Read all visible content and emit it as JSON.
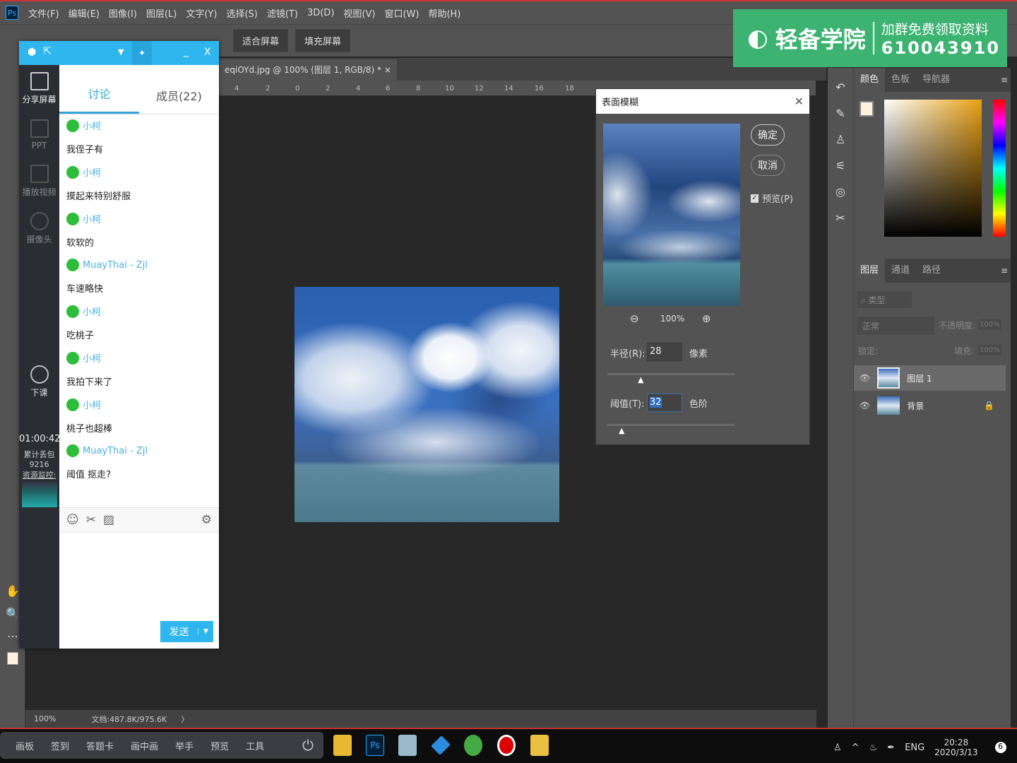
{
  "menu": {
    "items": [
      "文件(F)",
      "编辑(E)",
      "图像(I)",
      "图层(L)",
      "文字(Y)",
      "选择(S)",
      "滤镜(T)",
      "3D(D)",
      "视图(V)",
      "窗口(W)",
      "帮助(H)"
    ]
  },
  "options": {
    "zoom": "100%",
    "fit_screen": "适合屏幕",
    "fill_screen": "填充屏幕"
  },
  "document": {
    "tab": "eqiOYd.jpg @ 100% (图层 1, RGB/8) *",
    "close": "×"
  },
  "ruler": [
    "4",
    "2",
    "0",
    "2",
    "4",
    "6",
    "8",
    "10",
    "12",
    "14",
    "16",
    "18"
  ],
  "status": {
    "zoom": "100%",
    "doc": "文档:487.8K/975.6K",
    "arrow": "〉"
  },
  "banner": {
    "brand": "轻备学院",
    "line1": "加群免费领取资料",
    "line2": "610043910"
  },
  "chat": {
    "side": [
      {
        "label": "分享屏幕"
      },
      {
        "label": "PPT"
      },
      {
        "label": "播放视频"
      },
      {
        "label": "摄像头"
      },
      {
        "label": "下课"
      }
    ],
    "timer": "01:00:42",
    "loss_label": "累计丢包",
    "loss": "9216",
    "monitor": "资源监控:",
    "tabs": [
      "讨论",
      "成员(22)"
    ],
    "messages": [
      {
        "name": "小柯",
        "text": "我侄子有"
      },
      {
        "name": "小柯",
        "text": "摸起来特别舒服"
      },
      {
        "name": "小柯",
        "text": "软软的"
      },
      {
        "name": "MuayThai - Zjl",
        "text": "车速略快"
      },
      {
        "name": "小柯",
        "text": "吃桃子"
      },
      {
        "name": "小柯",
        "text": "我拍下来了"
      },
      {
        "name": "小柯",
        "text": "桃子也超棒"
      },
      {
        "name": "MuayThai - Zjl",
        "text": "阈值 抠走?"
      }
    ],
    "send": "发送"
  },
  "dialog": {
    "title": "表面模糊",
    "ok": "确定",
    "cancel": "取消",
    "preview": "预览(P)",
    "preview_checked": true,
    "zoom": "100%",
    "radius_label": "半径(R):",
    "radius": "28",
    "radius_unit": "像素",
    "threshold_label": "阈值(T):",
    "threshold": "32",
    "threshold_unit": "色阶"
  },
  "color_panel": {
    "tabs": [
      "颜色",
      "色板",
      "导航器"
    ]
  },
  "layers_panel": {
    "tabs": [
      "图层",
      "通道",
      "路径"
    ],
    "filter": "类型",
    "blend": "正常",
    "opacity_label": "不透明度:",
    "opacity": "100%",
    "lock_label": "锁定:",
    "fill_label": "填充:",
    "fill": "100%",
    "layers": [
      {
        "name": "图层 1",
        "selected": true
      },
      {
        "name": "背景",
        "locked": true
      }
    ]
  },
  "classbar": [
    "画板",
    "签到",
    "答题卡",
    "画中画",
    "举手",
    "预览",
    "工具"
  ],
  "tray": {
    "lang": "ENG",
    "time": "20:28",
    "date": "2020/3/13",
    "notif": "6"
  }
}
